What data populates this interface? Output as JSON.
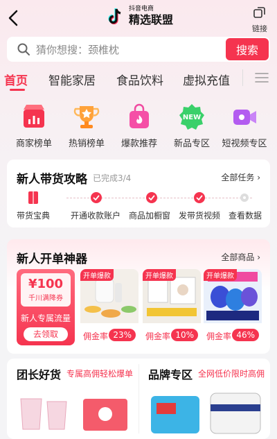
{
  "header": {
    "logo_small": "抖音电商",
    "logo_big": "精选联盟",
    "link_label": "链接"
  },
  "search": {
    "placeholder": "猜你想搜：颈椎枕",
    "button": "搜索"
  },
  "tabs": [
    {
      "label": "首页",
      "active": true
    },
    {
      "label": "智能家居"
    },
    {
      "label": "食品饮料"
    },
    {
      "label": "虚拟充值"
    }
  ],
  "categories": [
    {
      "label": "商家榜单",
      "icon": "shop-chart-icon"
    },
    {
      "label": "热销榜单",
      "icon": "trophy-icon"
    },
    {
      "label": "爆款推荐",
      "icon": "shopping-bag-fire-icon"
    },
    {
      "label": "新品专区",
      "icon": "new-badge-icon"
    },
    {
      "label": "短视频专区",
      "icon": "video-camera-icon"
    }
  ],
  "strategy": {
    "title": "新人带货攻略",
    "progress": "已完成3/4",
    "more": "全部任务",
    "steps": [
      {
        "label": "带货宝典",
        "done": true
      },
      {
        "label": "开通收款账户",
        "done": true
      },
      {
        "label": "商品加橱窗",
        "done": true
      },
      {
        "label": "发带货视频",
        "done": true
      },
      {
        "label": "查看数据",
        "done": false
      }
    ]
  },
  "tools": {
    "title": "新人开单神器",
    "more": "全部商品",
    "coupon": {
      "amount": "¥100",
      "desc": "千川满降券",
      "flow": "新人专属流量",
      "claim": "去领取"
    },
    "products": [
      {
        "tag": "开单爆款",
        "rate_label": "佣金率",
        "rate": "23%"
      },
      {
        "tag": "开单爆款",
        "rate_label": "佣金率",
        "rate": "10%"
      },
      {
        "tag": "开单爆款",
        "rate_label": "佣金率",
        "rate": "46%"
      }
    ]
  },
  "bottom": {
    "left": {
      "title": "团长好货",
      "subtitle": "专属高佣轻松爆单"
    },
    "right": {
      "title": "品牌专区",
      "subtitle": "全网低价限时高佣"
    }
  },
  "colors": {
    "accent": "#f5344f"
  }
}
